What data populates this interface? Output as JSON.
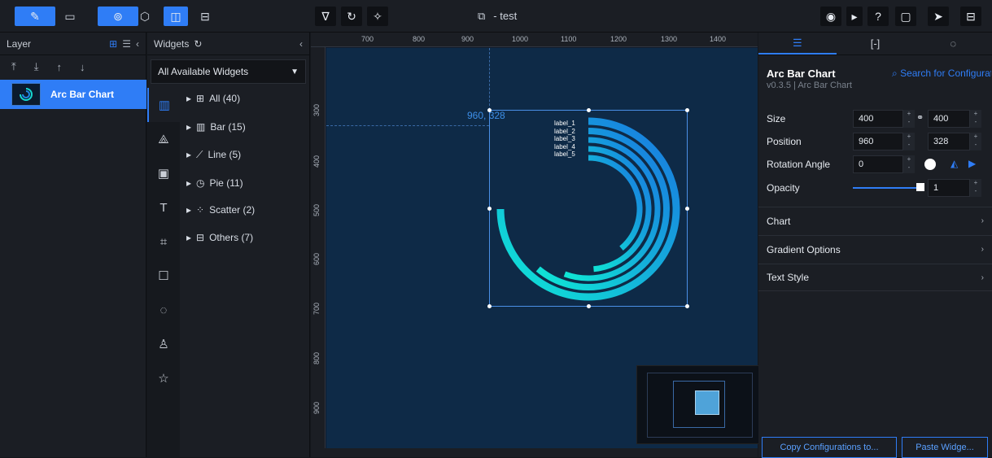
{
  "topbar": {
    "doc_title": "- test"
  },
  "layer_panel": {
    "title": "Layer",
    "item_label": "Arc Bar Chart"
  },
  "widgets_panel": {
    "title": "Widgets",
    "dropdown_value": "All Available Widgets",
    "tree": [
      {
        "label": "All (40)"
      },
      {
        "label": "Bar (15)"
      },
      {
        "label": "Line (5)"
      },
      {
        "label": "Pie (11)"
      },
      {
        "label": "Scatter (2)"
      },
      {
        "label": "Others (7)"
      }
    ]
  },
  "canvas": {
    "ruler_x": [
      "700",
      "800",
      "900",
      "1000",
      "1100",
      "1200",
      "1300",
      "1400"
    ],
    "ruler_y": [
      "300",
      "400",
      "500",
      "600",
      "700",
      "800",
      "900"
    ],
    "coord_label": "960, 328"
  },
  "chart_data": {
    "type": "arc-bar",
    "categories": [
      "label_1",
      "label_2",
      "label_3",
      "label_4",
      "label_5"
    ],
    "values": [
      270,
      220,
      200,
      175,
      140
    ],
    "value_unit": "degrees of sweep (estimated)",
    "gradient_colors": [
      "#0fe7d5",
      "#1976e0"
    ]
  },
  "props_panel": {
    "component_title": "Arc Bar Chart",
    "version": "v0.3.5 | Arc Bar Chart",
    "search_label": "Search for Configurati",
    "size_label": "Size",
    "size_w": "400",
    "size_h": "400",
    "position_label": "Position",
    "pos_x": "960",
    "pos_y": "328",
    "rotation_label": "Rotation Angle",
    "rotation_value": "0",
    "opacity_label": "Opacity",
    "opacity_value": "1",
    "sections": [
      "Chart",
      "Gradient Options",
      "Text Style"
    ],
    "copy_btn": "Copy Configurations to...",
    "paste_btn": "Paste Widge..."
  },
  "colors": {
    "accent": "#2f7df6",
    "stage": "#0e2a47"
  }
}
